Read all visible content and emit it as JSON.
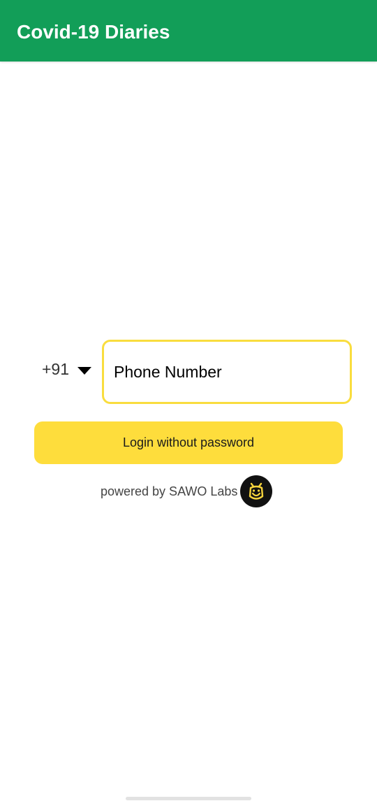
{
  "app_bar": {
    "title": "Covid-19 Diaries",
    "color": "#129e58"
  },
  "login": {
    "country_code": "+91",
    "dropdown_icon": "caret-down-icon",
    "phone_placeholder": "Phone Number",
    "phone_value": "",
    "submit_label": "Login without password",
    "accent_color": "#fedd3c"
  },
  "footer": {
    "powered_by": "powered by SAWO Labs",
    "logo_icon": "sawo-logo-icon"
  }
}
